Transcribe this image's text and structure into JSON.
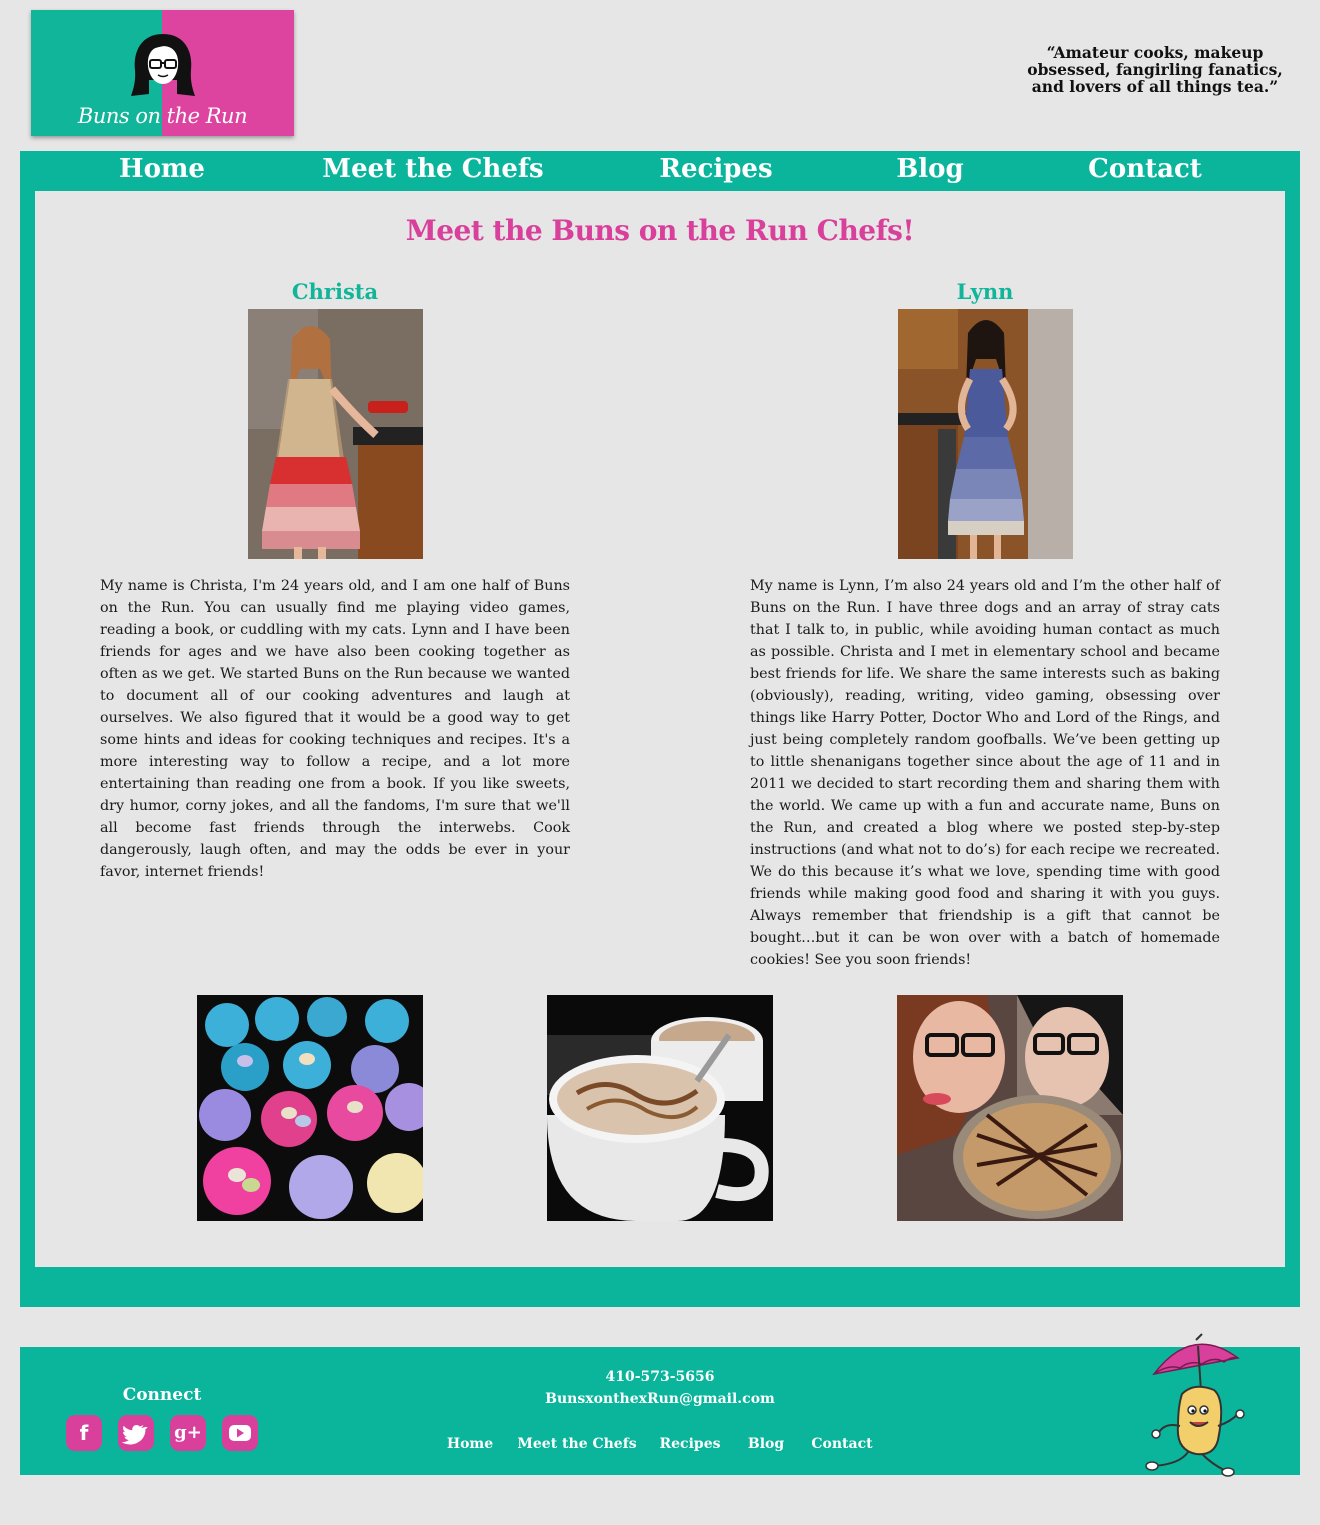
{
  "brand": {
    "logo_text": "Buns on the Run",
    "tagline": "“Amateur cooks, makeup obsessed, fangirling fanatics, and lovers of all things tea.”",
    "colors": {
      "teal": "#0ab59c",
      "pink": "#d8409b",
      "background": "#e6e6e6"
    }
  },
  "nav": {
    "items": [
      {
        "label": "Home"
      },
      {
        "label": "Meet the Chefs"
      },
      {
        "label": "Recipes"
      },
      {
        "label": "Blog"
      },
      {
        "label": "Contact"
      }
    ]
  },
  "main": {
    "title": "Meet the Buns on the Run Chefs!",
    "chefs": [
      {
        "name": "Christa",
        "photo": "christa-photo",
        "bio": "My name is Christa, I'm 24 years old, and I am one half of Buns on the Run. You can usually find me playing video games, reading a book, or cuddling with my cats. Lynn and I have been friends for ages and we have also been cooking together as often as we get. We started Buns on the Run because we wanted to document all of our cooking adventures and laugh at ourselves. We also figured that it would be a good way to get some hints and ideas for cooking techniques and recipes. It's a more interesting way to follow a recipe, and a lot more entertaining than reading one from a book. If you like sweets, dry humor, corny jokes, and all the fandoms, I'm sure that we'll all become fast friends through the interwebs. Cook dangerously, laugh often, and may the odds be ever in your favor, internet friends!"
      },
      {
        "name": "Lynn",
        "photo": "lynn-photo",
        "bio": "My name is Lynn, I’m also 24 years old and I’m the other half of Buns on the Run. I have three dogs and an array of stray cats that I talk to, in public, while avoiding human contact as much as possible. Christa and I met in elementary school and became best friends for life. We share the same interests such as baking (obviously), reading, writing, video gaming, obsessing over things like Harry Potter, Doctor Who and Lord of the Rings, and just being completely random goofballs. We’ve been getting up to little shenanigans together since about the age of 11 and in 2011 we decided to start recording them and sharing them with the world. We came up with a fun and accurate name, Buns on the Run, and created a blog where we posted step-by-step instructions (and what not to do’s) for each recipe we recreated. We do this because it’s what we love, spending time with good friends while making good food and sharing it with you guys. Always remember that friendship is a gift that cannot be bought…but it can be won over with a batch of homemade cookies! See you soon friends!"
      }
    ],
    "gallery": [
      "cupcakes-photo",
      "hot-chocolate-photo",
      "chefs-with-pie-photo"
    ]
  },
  "footer": {
    "connect_label": "Connect",
    "social": [
      {
        "icon": "facebook-icon",
        "glyph": "f"
      },
      {
        "icon": "twitter-icon",
        "glyph": "t"
      },
      {
        "icon": "google-plus-icon",
        "glyph": "g+"
      },
      {
        "icon": "youtube-icon",
        "glyph": "▶"
      }
    ],
    "phone": "410-573-5656",
    "email": "BunsxonthexRun@gmail.com",
    "nav": [
      "Home",
      "Meet the Chefs",
      "Recipes",
      "Blog",
      "Contact"
    ],
    "mascot": "bun-mascot-with-umbrella"
  }
}
